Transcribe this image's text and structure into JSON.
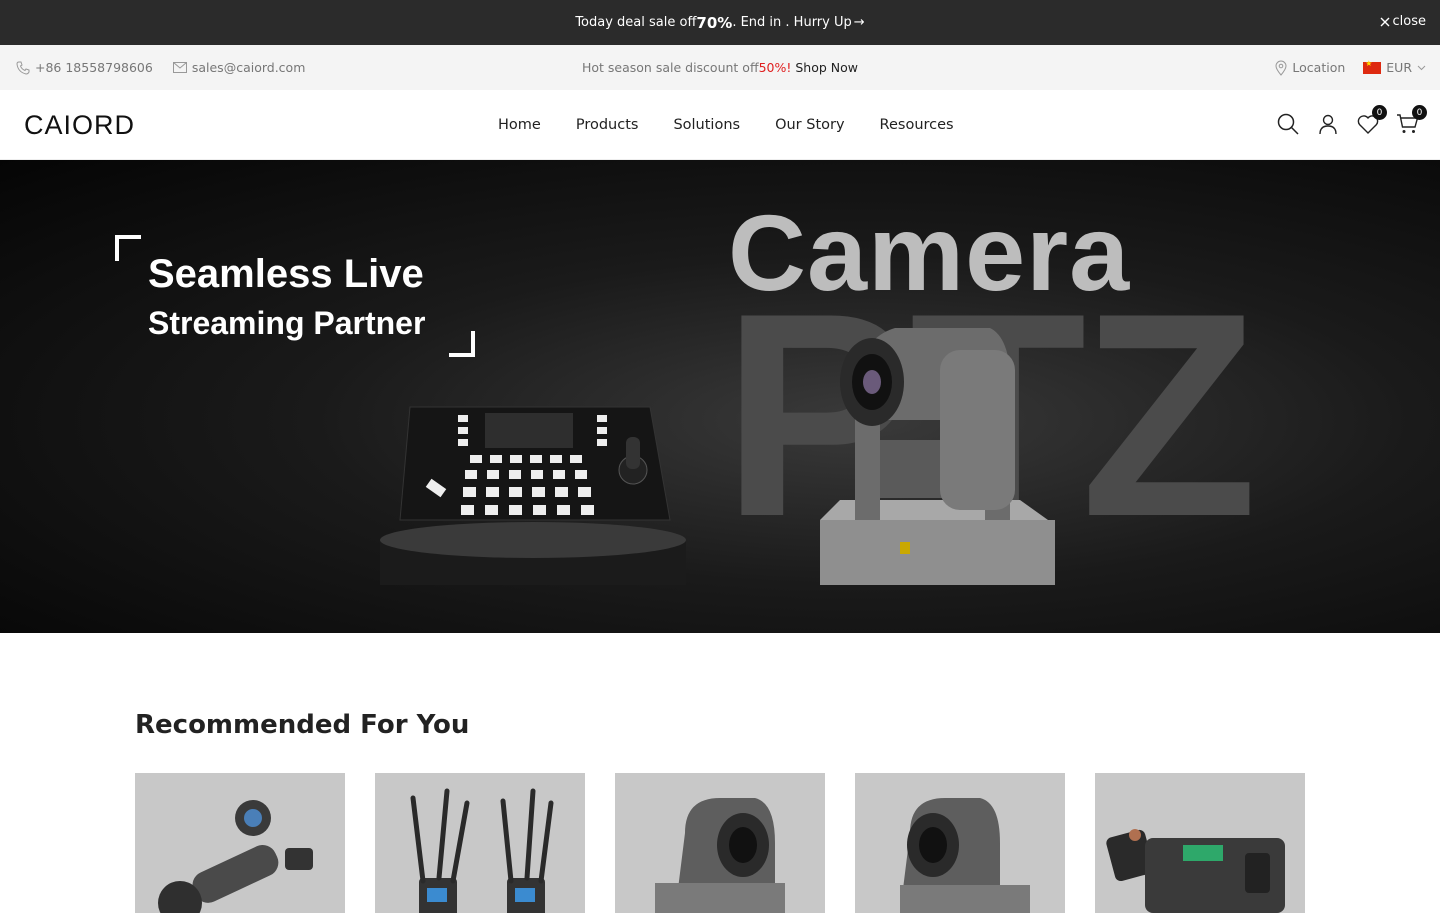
{
  "announcement": {
    "text_before": "Today deal sale off ",
    "highlight": "70%",
    "text_after": ". End in . Hurry Up",
    "arrow": "→",
    "close_label": "close"
  },
  "infobar": {
    "phone": "+86 18558798606",
    "email": "sales@caiord.com",
    "promo_before": "Hot season sale discount off ",
    "promo_pct": "50%",
    "promo_excl": "!",
    "shop_now": "Shop Now",
    "location": "Location",
    "currency": "EUR"
  },
  "header": {
    "logo": "CAIORD",
    "nav": [
      "Home",
      "Products",
      "Solutions",
      "Our Story",
      "Resources"
    ],
    "wishlist_count": "0",
    "cart_count": "0"
  },
  "hero": {
    "headline_line1": "Seamless Live",
    "headline_line2": "Streaming Partner",
    "word_camera": "Camera",
    "word_ptz": "PTZ"
  },
  "recommended": {
    "title": "Recommended For You",
    "products": [
      {
        "icon": "action-camera-kit"
      },
      {
        "icon": "wireless-video-transmitter"
      },
      {
        "icon": "ptz-camera"
      },
      {
        "icon": "ptz-camera"
      },
      {
        "icon": "wireless-microphone-kit"
      }
    ]
  },
  "colors": {
    "announce_bg": "#2b2b2b",
    "promo_red": "#e02020",
    "hero_bg": "#0b0b0b",
    "card_bg": "#c8c8c8"
  }
}
